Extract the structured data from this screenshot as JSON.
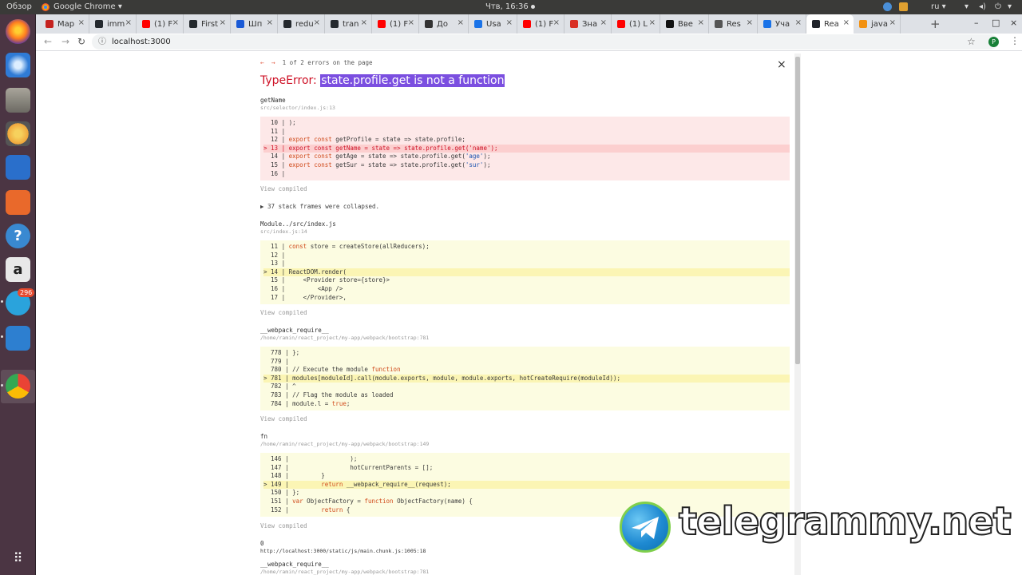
{
  "topbar": {
    "overview": "Обзор",
    "app_name": "Google Chrome",
    "clock": "Чтв, 16:36",
    "lang": "ru"
  },
  "launcher": {
    "badge": "296",
    "apps": [
      "firefox-icon",
      "thunderbird-icon",
      "files-icon",
      "rhythmbox-icon",
      "libreoffice-writer-icon",
      "software-center-icon",
      "help-icon",
      "amazon-icon",
      "telegram-icon",
      "vscode-icon",
      "chrome-icon",
      "app-grid-icon"
    ]
  },
  "tabs": [
    {
      "label": "Map",
      "color": "#c5221f"
    },
    {
      "label": "imm",
      "color": "#24292e"
    },
    {
      "label": "(1) F",
      "color": "#ff0000"
    },
    {
      "label": "First",
      "color": "#24292e"
    },
    {
      "label": "Шп",
      "color": "#1a5ad6"
    },
    {
      "label": "redu",
      "color": "#24292e"
    },
    {
      "label": "tran",
      "color": "#24292e"
    },
    {
      "label": "(1) F",
      "color": "#ff0000"
    },
    {
      "label": "До",
      "color": "#333333"
    },
    {
      "label": "Usa",
      "color": "#1a73e8"
    },
    {
      "label": "(1) F",
      "color": "#ff0000"
    },
    {
      "label": "Зна",
      "color": "#d93025"
    },
    {
      "label": "(1) L",
      "color": "#ff0000"
    },
    {
      "label": "Вве",
      "color": "#111111"
    },
    {
      "label": "Res",
      "color": "#555555"
    },
    {
      "label": "Уча",
      "color": "#1a73e8"
    },
    {
      "label": "Rea",
      "color": "#20232a"
    },
    {
      "label": "java",
      "color": "#f29111"
    }
  ],
  "toolbar": {
    "url": "localhost:3000",
    "profile_initial": "P"
  },
  "overlay": {
    "pager_text": "1 of 2 errors on the page",
    "error_type": "TypeError:",
    "error_message": "state.profile.get is not a function",
    "collapsed_text": "▶ 37 stack frames were collapsed.",
    "view_compiled": "View compiled"
  },
  "frames": [
    {
      "name": "getName",
      "file": "src/selector/index.js:13",
      "lines": [
        "  10 | );",
        "  11 |",
        "  12 | export const getProfile = state => state.profile;",
        "> 13 | export const getName = state => state.profile.get('name');",
        "  14 | export const getAge = state => state.profile.get('age');",
        "  15 | export const getSur = state => state.profile.get('sur');",
        "  16 |"
      ]
    },
    {
      "name": "Module../src/index.js",
      "file": "src/index.js:14",
      "lines": [
        "  11 | const store = createStore(allReducers);",
        "  12 |",
        "  13 |",
        "> 14 | ReactDOM.render(",
        "  15 |     <Provider store={store}>",
        "  16 |         <App />",
        "  17 |     </Provider>,"
      ]
    },
    {
      "name": "__webpack_require__",
      "file": "/home/ramin/react_project/my-app/webpack/bootstrap:781",
      "lines": [
        "  778 | };",
        "  779 |",
        "  780 | // Execute the module function",
        "> 781 | modules[moduleId].call(module.exports, module, module.exports, hotCreateRequire(moduleId));",
        "  782 | ^",
        "  783 | // Flag the module as loaded",
        "  784 | module.l = true;"
      ]
    },
    {
      "name": "fn",
      "file": "/home/ramin/react_project/my-app/webpack/bootstrap:149",
      "lines": [
        "  146 |                 );",
        "  147 |                 hotCurrentParents = [];",
        "  148 |         }",
        "> 149 |         return __webpack_require__(request);",
        "  150 | };",
        "  151 | var ObjectFactory = function ObjectFactory(name) {",
        "  152 |         return {"
      ]
    },
    {
      "name": "0",
      "file": "http://localhost:3000/static/js/main.chunk.js:1005:18"
    },
    {
      "name": "__webpack_require__",
      "file": "/home/ramin/react_project/my-app/webpack/bootstrap:781"
    }
  ],
  "watermark": "telegrammy.net"
}
